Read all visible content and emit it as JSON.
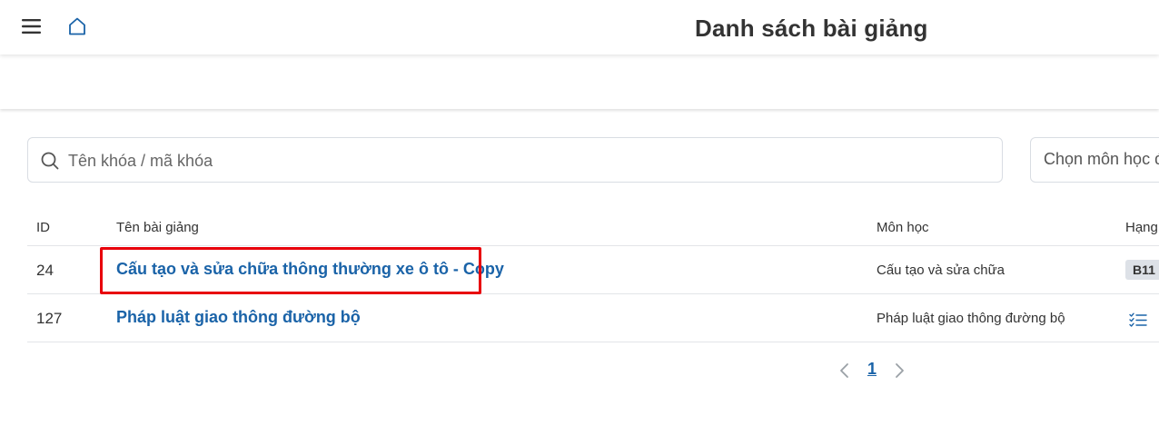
{
  "header": {
    "title": "Danh sách bài giảng",
    "menu_icon": "hamburger-menu-icon",
    "home_icon": "home-icon"
  },
  "filters": {
    "search_placeholder": "Tên khóa / mã khóa",
    "search_value": "",
    "subject_select_placeholder": "Chọn môn học đ"
  },
  "table": {
    "columns": [
      "ID",
      "Tên bài giảng",
      "Môn học",
      "Hạng"
    ],
    "rows": [
      {
        "id": "24",
        "name": "Cấu tạo và sửa chữa thông thường xe ô tô - Copy",
        "subject": "Cấu tạo và sửa chữa",
        "rank": "B11"
      },
      {
        "id": "127",
        "name": "Pháp luật giao thông đường bộ",
        "subject": "Pháp luật giao thông đường bộ",
        "rank_icon": "checklist-icon"
      }
    ]
  },
  "pagination": {
    "current_page": "1"
  },
  "colors": {
    "link": "#1a63a8",
    "highlight": "#e8000b",
    "badge_bg": "#dde1e7"
  }
}
